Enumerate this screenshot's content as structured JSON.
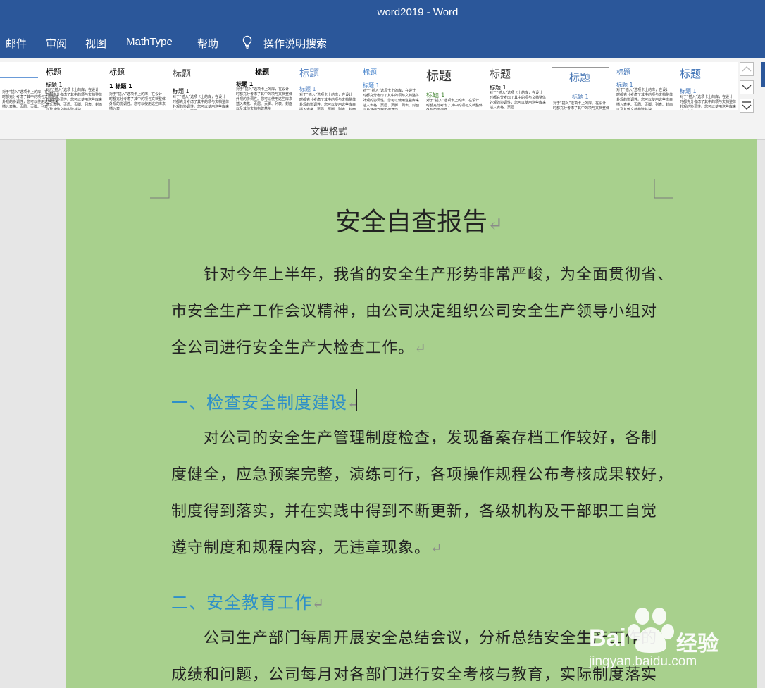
{
  "window": {
    "title": "word2019  -  Word"
  },
  "tabs": [
    {
      "label": "邮件"
    },
    {
      "label": "审阅"
    },
    {
      "label": "视图"
    },
    {
      "label": "MathType"
    },
    {
      "label": "帮助"
    }
  ],
  "search": {
    "label": "操作说明搜索"
  },
  "gallery": {
    "group_label": "文档格式",
    "tiles": [
      {
        "title": "",
        "head": "",
        "body": "对于“插入”选项卡上的库，在设计时都充分考虑了其中的项与文档整体外观的协调性，您可以使用这些库来插入表格、页眉、页脚、列表"
      },
      {
        "title": "标题",
        "head": "标题 1",
        "body": "对于“插入”选项卡上的库，在设计时都充分考虑了其中的项与文档整体外观的协调性。您可以使用这些库来插入表格、页眉、页脚、列表、封面以及其他文档构建基块"
      },
      {
        "title": "标题",
        "head": "1  标题 1",
        "body": "对于“插入”选项卡上的库，在设计时都充分考虑了其中的项与文档整体外观的协调性。您可以使用这些库来插入表"
      },
      {
        "title": "标题",
        "head": "标题 1",
        "body": "对于“插入”选项卡上的库，在设计时都充分考虑了其中的项与文档整体外观的协调性。您可以使用这些库来插入表格、页眉"
      },
      {
        "title": "标题",
        "head": "标题 1",
        "body": "对于“插入”选项卡上的库，在设计时都充分考虑了其中的项与文档整体外观的协调性。您可以使用这些库来插入表格、页眉、页脚、列表、封面以及其他文档构建基块"
      },
      {
        "title": "标题",
        "head": "标题 1",
        "body": "对于“插入”选项卡上的库，在设计时都充分考虑了其中的项与文档整体外观的协调性。您可以使用这些库来插入表格、页眉、页脚、列表、封面以及其他"
      },
      {
        "title": "标题",
        "head": "标题 1",
        "body": "对于“插入”选项卡上的库，在设计时都充分考虑了其中的项与文档整体外观的协调性。您可以使用这些库来插入表格、页眉、页脚、列表、封面以及其他文档构建基块"
      },
      {
        "title": "标题",
        "head": "标题 1",
        "body": "对于“插入”选项卡上的库，在设计时都充分考虑了其中的项与文档整体外观的协调性"
      },
      {
        "title": "标题",
        "head": "标题 1",
        "body": "对于“插入”选项卡上的库，在设计时都充分考虑了其中的项与文档整体外观的协调性，您可以使用这些库来插入表格、页眉"
      },
      {
        "title": "标题",
        "head": "标题 1",
        "body": "对于“插入”选项卡上的库，在设计时都充分考虑了其中的项与文档整体外观的协调性"
      },
      {
        "title": "标题",
        "head": "标题 1",
        "body": "对于“插入”选项卡上的库，在设计时都充分考虑了其中的项与文档整体外观的协调性。您可以使用这些库来插入表格、页眉、页脚、列表、封面以及其他文档构建基块"
      },
      {
        "title": "标题",
        "head": "标题 1",
        "body": "对于“插入”选项卡上的库，在设计时都充分考虑了其中的项与文档整体外观的协调性。您可以使用这些库来插入表格"
      }
    ]
  },
  "document": {
    "title": "安全自查报告",
    "intro_lines": [
      "针对今年上半年，我省的安全生产形势非常严峻，为全面贯彻省、",
      "市安全生产工作会议精神，由公司决定组织公司安全生产领导小组对",
      "全公司进行安全生产大检查工作。"
    ],
    "heading1": "一、检查安全制度建设",
    "section1_lines": [
      "对公司的安全生产管理制度检查，发现备案存档工作较好，各制",
      "度健全，应急预案完整，演练可行，各项操作规程公布考核成果较好，",
      "制度得到落实，并在实践中得到不断更新，各级机构及干部职工自觉",
      "遵守制度和规程内容，无违章现象。"
    ],
    "heading2": "二、安全教育工作",
    "section2_lines": [
      "公司生产部门每周开展安全总结会议，分析总结安全生产工作的",
      "成绩和问题，公司每月对各部门进行安全考核与教育，实际制度落实"
    ],
    "paragraph_mark": "↵"
  },
  "watermark": {
    "brand": "Bai",
    "brand2": "经验",
    "url": "jingyan.baidu.com"
  },
  "colors": {
    "ribbon_blue": "#2b579a",
    "page_green": "#a8d08d",
    "heading_blue": "#2e8fc9"
  }
}
